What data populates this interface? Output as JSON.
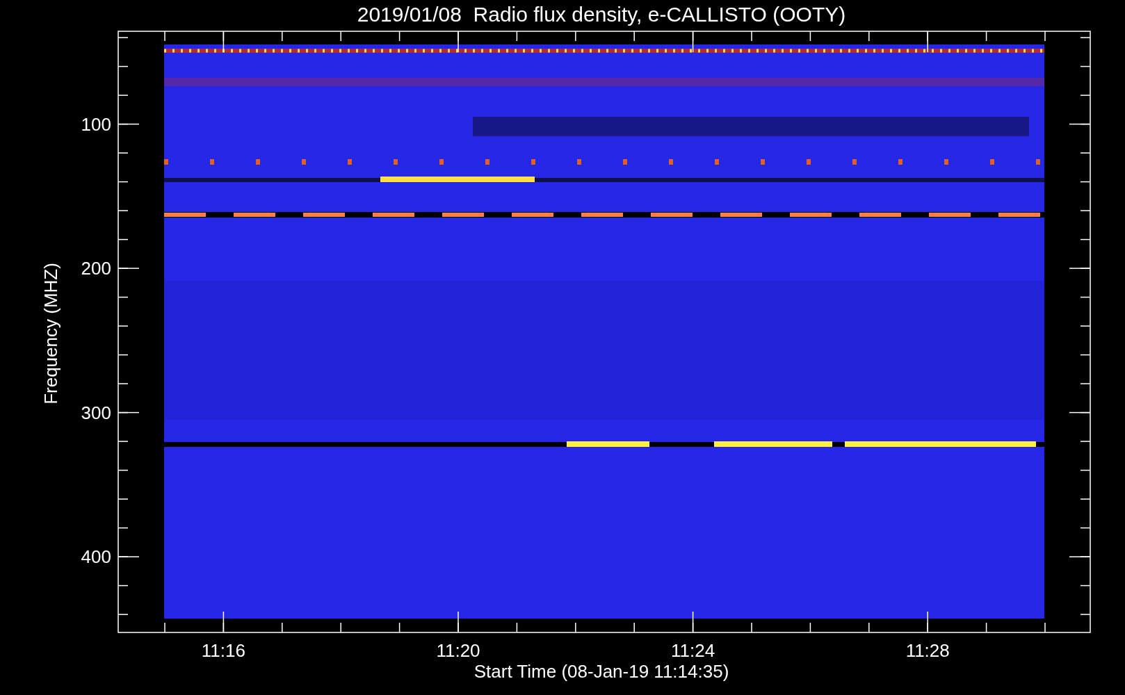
{
  "title": "2019/01/08  Radio flux density, e-CALLISTO (OOTY)",
  "y_axis": {
    "label": "Frequency (MHZ)",
    "ticks": [
      "100",
      "200",
      "300",
      "400"
    ]
  },
  "x_axis": {
    "label": "Start Time (08-Jan-19 11:14:35)",
    "ticks": [
      "11:16",
      "11:20",
      "11:24",
      "11:28"
    ]
  }
}
